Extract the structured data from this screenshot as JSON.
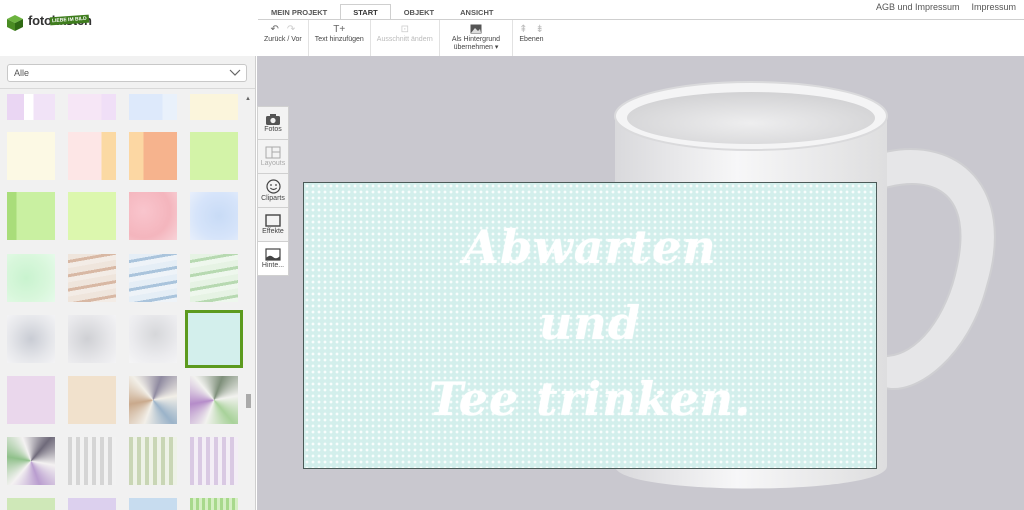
{
  "brand": {
    "name": "fotokasten",
    "tagline": "LIEBE IM BILD"
  },
  "tabs": [
    {
      "label": "MEIN PROJEKT",
      "active": false
    },
    {
      "label": "START",
      "active": true
    },
    {
      "label": "OBJEKT",
      "active": false
    },
    {
      "label": "ANSICHT",
      "active": false
    }
  ],
  "toplinks": {
    "agb": "AGB und Impressum",
    "impressum": "Impressum"
  },
  "toolbar": {
    "undo_redo": "Zurück / Vor",
    "add_text": "Text hinzufügen",
    "crop": "Ausschnitt ändern",
    "as_background_1": "Als Hintergrund",
    "as_background_2": "übernehmen ▾",
    "layers": "Ebenen"
  },
  "sidebar": {
    "filter_value": "Alle",
    "tabs": [
      {
        "label": "Fotos",
        "icon": "camera-icon",
        "enabled": true
      },
      {
        "label": "Layouts",
        "icon": "layout-icon",
        "enabled": false
      },
      {
        "label": "Cliparts",
        "icon": "smiley-icon",
        "enabled": true
      },
      {
        "label": "Effekte",
        "icon": "frame-icon",
        "enabled": true
      },
      {
        "label": "Hinte...",
        "icon": "background-icon",
        "enabled": true
      }
    ]
  },
  "design": {
    "line1": "Abwarten",
    "line2": "und",
    "line3": "Tee trinken."
  },
  "colors": {
    "accent_green": "#5c9a1e",
    "design_bg": "#d3efec",
    "workspace": "#c9c8cf"
  }
}
